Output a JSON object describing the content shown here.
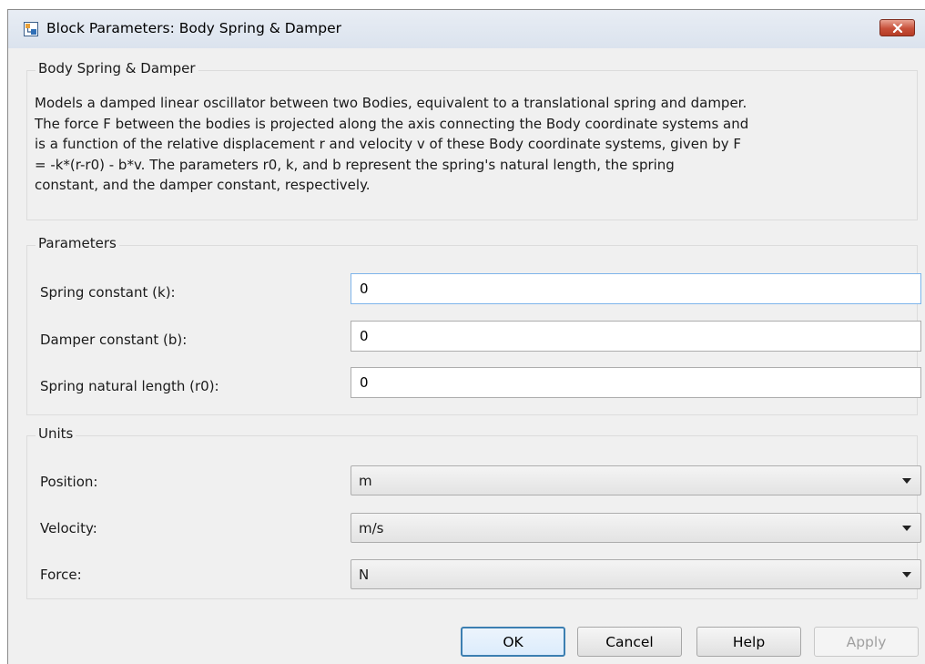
{
  "window": {
    "title": "Block Parameters: Body Spring & Damper"
  },
  "icons": {
    "app": "simulink-block-icon",
    "close": "close-icon",
    "dropdown": "chevron-down-icon"
  },
  "colors": {
    "close_button": "#c7503a",
    "focus_border": "#3c7fb1",
    "dialog_bg": "#f0f0f0"
  },
  "description": {
    "group_title": "Body Spring & Damper",
    "lines": [
      "Models a damped linear oscillator between two Bodies, equivalent to a translational spring and damper.",
      "The force F between the bodies is projected along the axis connecting the Body coordinate systems and",
      "is a function of the relative displacement r and velocity v of these Body coordinate systems, given by F",
      "= -k*(r-r0) - b*v. The parameters r0, k, and b represent the spring's natural length, the spring",
      "constant, and the damper constant, respectively."
    ]
  },
  "parameters": {
    "group_title": "Parameters",
    "spring_constant": {
      "label": "Spring constant (k):",
      "value": "0"
    },
    "damper_constant": {
      "label": "Damper constant (b):",
      "value": "0"
    },
    "natural_length": {
      "label": "Spring natural length (r0):",
      "value": "0"
    }
  },
  "units": {
    "group_title": "Units",
    "position": {
      "label": "Position:",
      "value": "m"
    },
    "velocity": {
      "label": "Velocity:",
      "value": "m/s"
    },
    "force": {
      "label": "Force:",
      "value": "N"
    }
  },
  "buttons": {
    "ok": "OK",
    "cancel": "Cancel",
    "help": "Help",
    "apply": "Apply"
  }
}
